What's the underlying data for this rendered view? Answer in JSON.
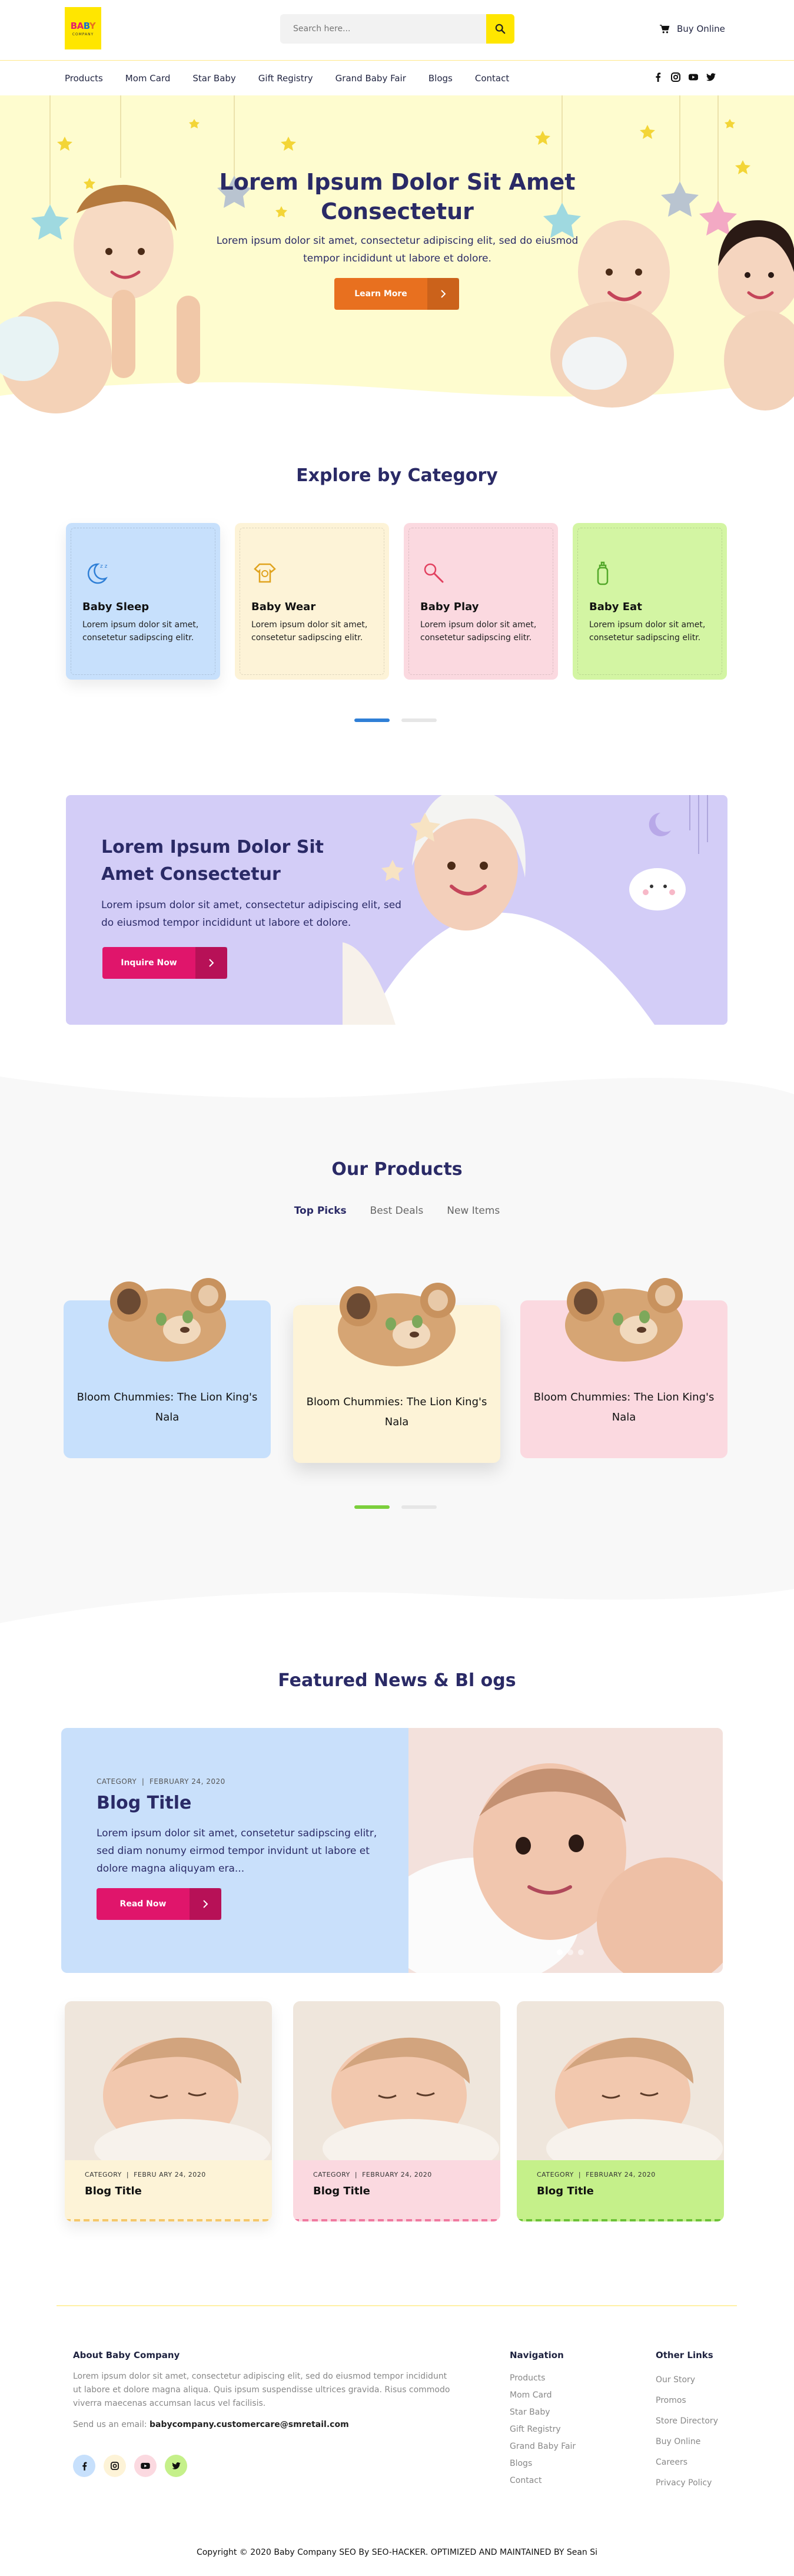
{
  "colors": {
    "brand_yellow": "#ffe600",
    "navy": "#2a2a66",
    "orange": "#e8701f",
    "pink": "#e0156b",
    "hero_bg": "#fefccf"
  },
  "header": {
    "logo": {
      "line1_a": "BA",
      "line1_b": "B",
      "line1_c": "Y",
      "line2": "COMPANY"
    },
    "search": {
      "placeholder": "Search here..."
    },
    "buy_online": "Buy Online"
  },
  "nav": {
    "items": [
      "Products",
      "Mom Card",
      "Star Baby",
      "Gift Registry",
      "Grand Baby Fair",
      "Blogs",
      "Contact"
    ],
    "social_icons": [
      "facebook-icon",
      "instagram-icon",
      "youtube-icon",
      "twitter-icon"
    ]
  },
  "hero": {
    "title": "Lorem Ipsum Dolor Sit Amet Consectetur",
    "text": "Lorem ipsum dolor sit amet, consectetur adipiscing elit, sed do eiusmod tempor incididunt ut labore et dolore.",
    "button": "Learn More"
  },
  "categories": {
    "title": "Explore by Category",
    "items": [
      {
        "title": "Baby Sleep",
        "text": "Lorem ipsum dolor sit amet, consetetur sadipscing elitr.",
        "icon": "moon-icon",
        "color": "#c7e0fc"
      },
      {
        "title": "Baby Wear",
        "text": "Lorem ipsum dolor sit amet, consetetur sadipscing elitr.",
        "icon": "onesie-icon",
        "color": "#fdf3d7"
      },
      {
        "title": "Baby Play",
        "text": "Lorem ipsum dolor sit amet, consetetur sadipscing elitr.",
        "icon": "rattle-icon",
        "color": "#fbd9e0"
      },
      {
        "title": "Baby Eat",
        "text": "Lorem ipsum dolor sit amet, consetetur sadipscing elitr.",
        "icon": "bottle-icon",
        "color": "#d3f5a3"
      }
    ]
  },
  "promo": {
    "title": "Lorem Ipsum Dolor Sit Amet Consectetur",
    "text": "Lorem ipsum dolor sit amet, consectetur adipiscing elit, sed do eiusmod tempor incididunt ut labore et dolore.",
    "button": "Inquire Now"
  },
  "products": {
    "title": "Our Products",
    "tabs": [
      "Top Picks",
      "Best Deals",
      "New Items"
    ],
    "active_tab": "Top Picks",
    "items": [
      {
        "name": "Bloom Chummies: The Lion King's Nala",
        "color": "#c7e0fc"
      },
      {
        "name": "Bloom Chummies: The Lion King's Nala",
        "color": "#fdf3d7"
      },
      {
        "name": "Bloom Chummies: The Lion King's Nala",
        "color": "#fbd9e0"
      }
    ]
  },
  "news": {
    "title": "Featured News & Bl ogs",
    "featured": {
      "category": "CATEGORY",
      "date": "FEBRUARY 24, 2020",
      "title": "Blog Title",
      "text": "Lorem ipsum dolor sit amet, consetetur sadipscing elitr, sed diam nonumy eirmod tempor invidunt ut labore et dolore magna aliquyam era...",
      "button": "Read Now"
    },
    "cards": [
      {
        "category": "CATEGORY",
        "date": "FEBRU ARY 24, 2020",
        "title": "Blog Title",
        "color": "#fdf3d7",
        "dash": "#f5c76a"
      },
      {
        "category": "CATEGORY",
        "date": "FEBRUARY 24, 2020",
        "title": "Blog Title",
        "color": "#fbd9e0",
        "dash": "#f07aa0"
      },
      {
        "category": "CATEGORY",
        "date": "FEBRUARY 24, 2020",
        "title": "Blog Title",
        "color": "#c5f08a",
        "dash": "#6cc237"
      }
    ]
  },
  "footer": {
    "about_title": "About Baby Company",
    "about_text": "Lorem ipsum dolor sit amet, consectetur adipiscing elit, sed do eiusmod tempor incididunt ut labore et dolore magna aliqua. Quis ipsum suspendisse ultrices gravida. Risus commodo viverra maecenas accumsan lacus vel facilisis.",
    "email_label": "Send us an email:",
    "email": "babycompany.customercare@smretail.com",
    "social_icons": [
      "facebook-icon",
      "instagram-icon",
      "youtube-icon",
      "twitter-icon"
    ],
    "nav_title": "Navigation",
    "nav_links": [
      "Products",
      "Mom Card",
      "Star Baby",
      "Gift Registry",
      "Grand Baby Fair",
      "Blogs",
      "Contact"
    ],
    "other_title": "Other Links",
    "other_links": [
      "Our Story",
      "Promos",
      "Store Directory",
      "Buy Online",
      "Careers",
      "Privacy Policy"
    ],
    "copyright": "Copyright © 2020 Baby Company SEO By SEO-HACKER. OPTIMIZED AND MAINTAINED BY Sean Si"
  }
}
